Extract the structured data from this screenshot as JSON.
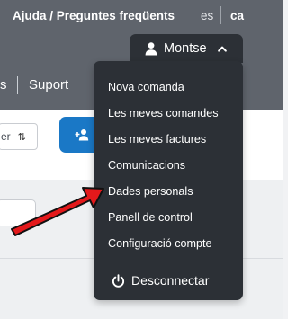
{
  "header": {
    "help_link": "Ajuda / Preguntes freqüents",
    "languages": {
      "es": "es",
      "ca": "ca"
    },
    "user_menu": {
      "name": "Montse",
      "icon": "user-icon",
      "chevron": "chevron-up-icon"
    }
  },
  "nav": {
    "partial_item": "s",
    "suport": "Suport"
  },
  "toolbar": {
    "sort_label_partial": "er",
    "sort_icon": "sort-arrows-icon",
    "add_icon": "add-user-icon"
  },
  "dropdown": {
    "items": [
      {
        "label": "Nova comanda"
      },
      {
        "label": "Les meves comandes"
      },
      {
        "label": "Les meves factures"
      },
      {
        "label": "Comunicacions"
      },
      {
        "label": "Dades personals"
      },
      {
        "label": "Panell de control"
      },
      {
        "label": "Configuració compte"
      }
    ],
    "logout": {
      "label": "Desconnectar",
      "icon": "power-icon"
    }
  },
  "annotation": {
    "arrow_color": "#e3191b",
    "arrow_target": "Dades personals"
  },
  "colors": {
    "topbar": "#5f646c",
    "dropdown": "#2c3036",
    "accent": "#1a78c6"
  }
}
